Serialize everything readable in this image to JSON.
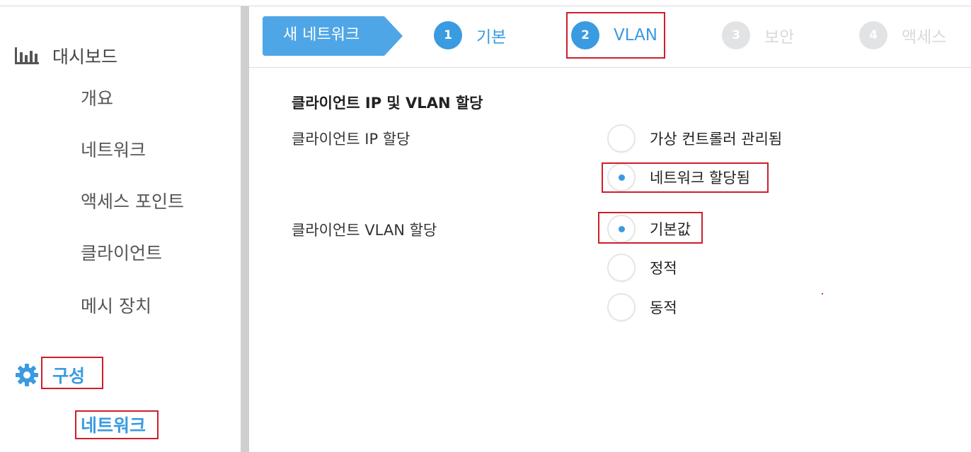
{
  "sidebar": {
    "dashboard": {
      "icon": "bar-chart-icon",
      "label": "대시보드"
    },
    "dashboard_items": [
      "개요",
      "네트워크",
      "액세스 포인트",
      "클라이언트",
      "메시 장치"
    ],
    "config": {
      "icon": "gear-icon",
      "label": "구성"
    },
    "config_items": [
      "네트워크"
    ]
  },
  "wizard": {
    "title": "새 네트워크",
    "steps": [
      {
        "number": "1",
        "label": "기본",
        "state": "done"
      },
      {
        "number": "2",
        "label": "VLAN",
        "state": "current"
      },
      {
        "number": "3",
        "label": "보안",
        "state": "pending"
      },
      {
        "number": "4",
        "label": "액세스",
        "state": "pending"
      }
    ]
  },
  "form": {
    "heading": "클라이언트 IP 및 VLAN 할당",
    "ip_assignment": {
      "label": "클라이언트 IP 할당",
      "options": [
        {
          "label": "가상 컨트롤러 관리됨",
          "selected": false
        },
        {
          "label": "네트워크 할당됨",
          "selected": true
        }
      ]
    },
    "vlan_assignment": {
      "label": "클라이언트 VLAN 할당",
      "options": [
        {
          "label": "기본값",
          "selected": true
        },
        {
          "label": "정적",
          "selected": false
        },
        {
          "label": "동적",
          "selected": false
        }
      ]
    }
  },
  "colors": {
    "accent": "#3a9be0",
    "highlight": "#cc1f2a",
    "inactive_step": "#e2e3e5"
  }
}
